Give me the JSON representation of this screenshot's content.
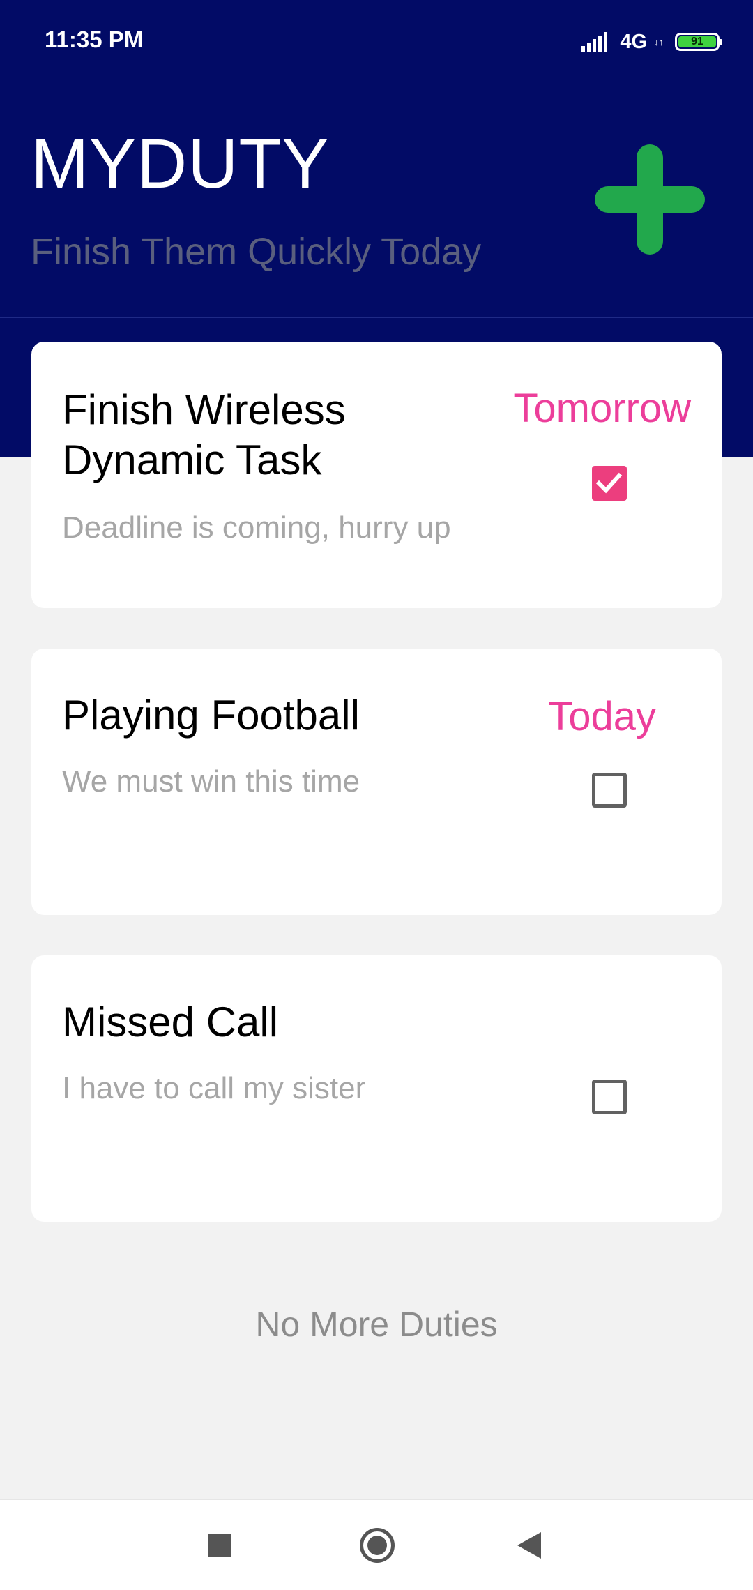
{
  "status_bar": {
    "time": "11:35 PM",
    "network": "4G",
    "network_arrows": "↓↑",
    "battery": "91",
    "icons": [
      "signal-icon",
      "battery-icon"
    ]
  },
  "header": {
    "title": "MYDUTY",
    "subtitle": "Finish Them Quickly Today",
    "add_icon": "plus-icon",
    "add_color": "#22a84c",
    "background_color": "#020b66"
  },
  "duties": [
    {
      "title": "Finish Wireless Dynamic Task",
      "description": "Deadline is coming, hurry up",
      "date": "Tomorrow",
      "checked": true
    },
    {
      "title": "Playing Football",
      "description": "We must win this time",
      "date": "Today",
      "checked": false
    },
    {
      "title": "Missed Call",
      "description": "I have to call my sister",
      "date": "",
      "checked": false
    }
  ],
  "footer": {
    "text": "No More Duties"
  },
  "nav": {
    "icons": [
      "recents-icon",
      "home-icon",
      "back-icon"
    ]
  },
  "colors": {
    "accent": "#ec3e9a",
    "checkbox_checked": "#ec3e7e"
  }
}
